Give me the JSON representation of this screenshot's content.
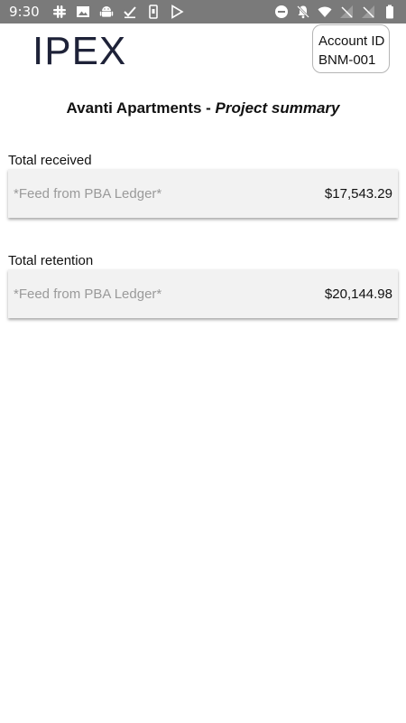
{
  "status_bar": {
    "time": "9:30",
    "left_icons": [
      "slack-icon",
      "image-icon",
      "android-icon",
      "check-icon",
      "phone-icon",
      "play-store-icon"
    ],
    "right_icons": [
      "do-not-disturb-icon",
      "notifications-off-icon",
      "wifi-icon",
      "signal-off-icon",
      "signal-off-icon",
      "battery-icon"
    ]
  },
  "header": {
    "logo": "IPEX",
    "account_label": "Account ID",
    "account_id": "BNM-001"
  },
  "title": {
    "project": "Avanti Apartments",
    "separator": " - ",
    "subtitle": "Project summary"
  },
  "fields": [
    {
      "label": "Total received",
      "placeholder": "*Feed from PBA Ledger*",
      "value": "$17,543.29"
    },
    {
      "label": "Total retention",
      "placeholder": "*Feed from PBA Ledger*",
      "value": "$20,144.98"
    }
  ],
  "colors": {
    "status_bar": "#7a7a7a",
    "logo": "#1e2238",
    "card_bg": "#f2f2f2",
    "placeholder": "#9a9a9a"
  }
}
